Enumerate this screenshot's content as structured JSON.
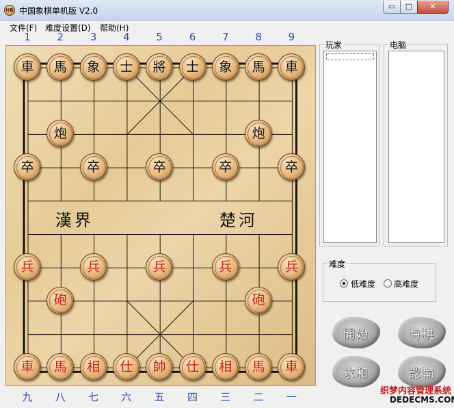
{
  "window": {
    "title": "中国象棋单机版 V2.0",
    "icon_text": "HB",
    "minimize_glyph": "▭",
    "maximize_glyph": "□",
    "close_glyph": "✕"
  },
  "menu": [
    {
      "label": "文件(F)"
    },
    {
      "label": "难度设置(D)"
    },
    {
      "label": "帮助(H)"
    }
  ],
  "board": {
    "top_numbers": [
      "1",
      "2",
      "3",
      "4",
      "5",
      "6",
      "7",
      "8",
      "9"
    ],
    "bottom_numbers": [
      "九",
      "八",
      "七",
      "六",
      "五",
      "四",
      "三",
      "二",
      "一"
    ],
    "river_left": "漢界",
    "river_right": "楚河",
    "pieces": [
      {
        "label": "車",
        "side": "black",
        "col": 0,
        "row": 0
      },
      {
        "label": "馬",
        "side": "black",
        "col": 1,
        "row": 0
      },
      {
        "label": "象",
        "side": "black",
        "col": 2,
        "row": 0
      },
      {
        "label": "士",
        "side": "black",
        "col": 3,
        "row": 0
      },
      {
        "label": "將",
        "side": "black",
        "col": 4,
        "row": 0
      },
      {
        "label": "士",
        "side": "black",
        "col": 5,
        "row": 0
      },
      {
        "label": "象",
        "side": "black",
        "col": 6,
        "row": 0
      },
      {
        "label": "馬",
        "side": "black",
        "col": 7,
        "row": 0
      },
      {
        "label": "車",
        "side": "black",
        "col": 8,
        "row": 0
      },
      {
        "label": "炮",
        "side": "black",
        "col": 1,
        "row": 2
      },
      {
        "label": "炮",
        "side": "black",
        "col": 7,
        "row": 2
      },
      {
        "label": "卒",
        "side": "black",
        "col": 0,
        "row": 3
      },
      {
        "label": "卒",
        "side": "black",
        "col": 2,
        "row": 3
      },
      {
        "label": "卒",
        "side": "black",
        "col": 4,
        "row": 3
      },
      {
        "label": "卒",
        "side": "black",
        "col": 6,
        "row": 3
      },
      {
        "label": "卒",
        "side": "black",
        "col": 8,
        "row": 3
      },
      {
        "label": "兵",
        "side": "red",
        "col": 0,
        "row": 6
      },
      {
        "label": "兵",
        "side": "red",
        "col": 2,
        "row": 6
      },
      {
        "label": "兵",
        "side": "red",
        "col": 4,
        "row": 6
      },
      {
        "label": "兵",
        "side": "red",
        "col": 6,
        "row": 6
      },
      {
        "label": "兵",
        "side": "red",
        "col": 8,
        "row": 6
      },
      {
        "label": "砲",
        "side": "red",
        "col": 1,
        "row": 7
      },
      {
        "label": "砲",
        "side": "red",
        "col": 7,
        "row": 7
      },
      {
        "label": "車",
        "side": "red",
        "col": 0,
        "row": 9
      },
      {
        "label": "馬",
        "side": "red",
        "col": 1,
        "row": 9
      },
      {
        "label": "相",
        "side": "red",
        "col": 2,
        "row": 9
      },
      {
        "label": "仕",
        "side": "red",
        "col": 3,
        "row": 9
      },
      {
        "label": "帥",
        "side": "red",
        "col": 4,
        "row": 9
      },
      {
        "label": "仕",
        "side": "red",
        "col": 5,
        "row": 9
      },
      {
        "label": "相",
        "side": "red",
        "col": 6,
        "row": 9
      },
      {
        "label": "馬",
        "side": "red",
        "col": 7,
        "row": 9
      },
      {
        "label": "車",
        "side": "red",
        "col": 8,
        "row": 9
      }
    ]
  },
  "side_panel": {
    "player_label": "玩家",
    "computer_label": "电脑",
    "difficulty_label": "难度",
    "difficulty_options": [
      {
        "label": "低难度",
        "checked": true
      },
      {
        "label": "高难度",
        "checked": false
      }
    ]
  },
  "buttons": [
    {
      "label": "開始"
    },
    {
      "label": "悔棋"
    },
    {
      "label": "求和"
    },
    {
      "label": "認輸"
    }
  ],
  "watermark": {
    "line1": "织梦内容管理系统",
    "line2": "DEDECMS.COM"
  },
  "colors": {
    "red_piece_text": "#c81e14",
    "black_piece_text": "#111111",
    "column_number": "#2c4ab4",
    "board_wood": "#e6cb97"
  }
}
